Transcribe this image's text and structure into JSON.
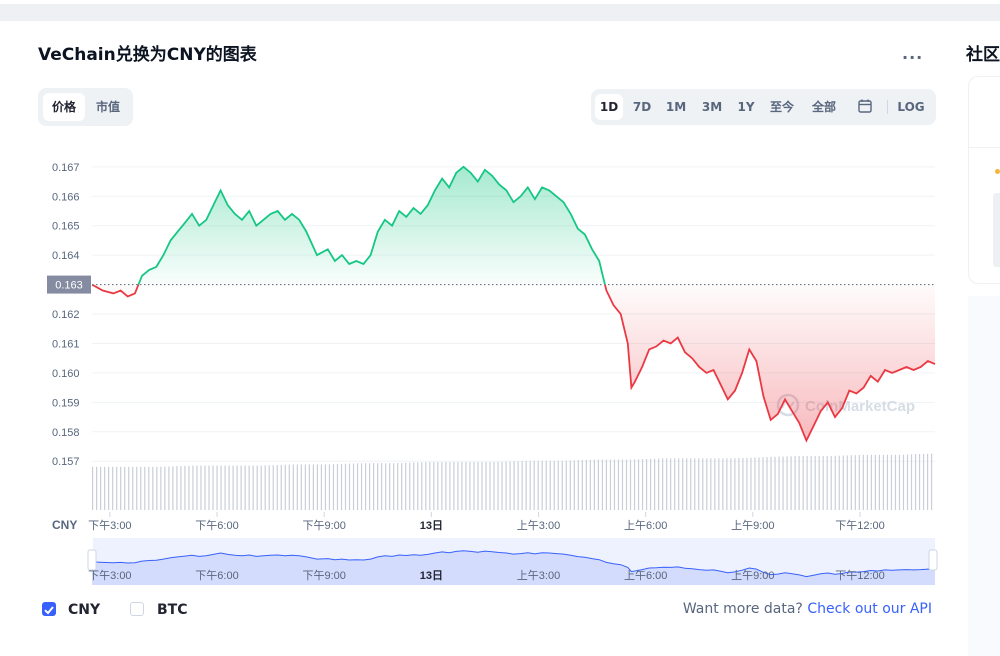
{
  "page": {
    "title": "VeChain兑换为CNY的图表",
    "more_label": "...",
    "side_title": "社区"
  },
  "tabs": [
    "价格",
    "市值"
  ],
  "ranges": [
    "1D",
    "7D",
    "1M",
    "3M",
    "1Y",
    "至今",
    "全部",
    "LOG"
  ],
  "range_active": "1D",
  "icons": {
    "calendar": "calendar-icon",
    "check": "check-icon",
    "watermark": "coinmarketcap-logo-icon"
  },
  "colors": {
    "up": "#16c784",
    "down": "#ea3943",
    "accent": "#3861fb",
    "grid": "#eff2f5",
    "text_muted": "#58667e"
  },
  "watermark": "CoinMarketCap",
  "currency_label": "CNY",
  "legend": {
    "cny": {
      "label": "CNY",
      "checked": true
    },
    "btc": {
      "label": "BTC",
      "checked": false
    }
  },
  "footer": {
    "prefix": "Want more data?",
    "link": "Check out our API"
  },
  "chart_data": {
    "type": "area",
    "y_ticks": [
      "0.167",
      "0.166",
      "0.165",
      "0.164",
      "0.163",
      "0.162",
      "0.161",
      "0.160",
      "0.159",
      "0.158",
      "0.157"
    ],
    "ylim": [
      0.1566,
      0.1673
    ],
    "baseline": 0.163,
    "baseline_label": "0.163",
    "x_ticks": [
      "下午3:00",
      "下午6:00",
      "下午9:00",
      "13日",
      "上午3:00",
      "上午6:00",
      "上午9:00",
      "下午12:00"
    ],
    "xlim": [
      0,
      23.6
    ],
    "x_tick_positions": [
      0.5,
      3.5,
      6.5,
      9.5,
      12.5,
      15.5,
      18.5,
      21.5
    ],
    "series": [
      {
        "x": [
          0,
          0.3,
          0.6,
          0.8,
          1.0,
          1.2,
          1.2,
          1.4,
          1.6,
          1.8,
          2.0,
          2.2,
          2.4,
          2.6,
          2.8,
          3.0,
          3.2,
          3.4,
          3.6,
          3.8,
          4.0,
          4.2,
          4.4,
          4.6,
          4.8,
          5.0,
          5.2,
          5.4,
          5.6,
          5.8,
          6.0,
          6.3,
          6.6,
          6.8,
          7.0,
          7.2,
          7.4,
          7.6,
          7.8,
          8.0,
          8.2,
          8.4,
          8.6,
          8.8,
          9.0,
          9.2,
          9.4,
          9.6,
          9.8,
          10.0,
          10.2,
          10.4,
          10.6,
          10.8,
          11.0,
          11.2,
          11.4,
          11.6,
          11.8,
          12.0,
          12.2,
          12.4,
          12.6,
          12.8,
          13.0,
          13.2,
          13.4,
          13.6,
          13.8,
          14.0,
          14.2,
          14.4,
          14.6,
          14.8,
          15.0,
          15.1,
          15.2,
          15.4,
          15.6,
          15.8,
          16.0,
          16.2,
          16.4,
          16.6,
          16.8,
          17.0,
          17.2,
          17.4,
          17.6,
          17.8,
          18.0,
          18.2,
          18.4,
          18.6,
          18.8,
          19.0,
          19.2,
          19.4,
          19.6,
          19.8,
          20.0,
          20.2,
          20.4,
          20.6,
          20.8,
          21.0,
          21.2,
          21.4,
          21.6,
          21.8,
          22.0,
          22.2,
          22.4,
          22.6,
          22.8,
          23.0,
          23.2,
          23.4,
          23.6
        ],
        "values": [
          0.163,
          0.1628,
          0.1627,
          0.1628,
          0.1626,
          0.1627,
          0.1627,
          0.1633,
          0.1635,
          0.1636,
          0.164,
          0.1645,
          0.1648,
          0.1651,
          0.1654,
          0.165,
          0.1652,
          0.1657,
          0.1662,
          0.1657,
          0.1654,
          0.1652,
          0.1655,
          0.165,
          0.1652,
          0.1654,
          0.1655,
          0.1652,
          0.1654,
          0.1652,
          0.1648,
          0.164,
          0.1642,
          0.1638,
          0.164,
          0.1637,
          0.1638,
          0.1637,
          0.164,
          0.1648,
          0.1652,
          0.165,
          0.1655,
          0.1653,
          0.1656,
          0.1654,
          0.1657,
          0.1662,
          0.1666,
          0.1663,
          0.1668,
          0.167,
          0.1668,
          0.1665,
          0.1669,
          0.1667,
          0.1664,
          0.1662,
          0.1658,
          0.166,
          0.1663,
          0.1659,
          0.1663,
          0.1662,
          0.166,
          0.1658,
          0.1654,
          0.1649,
          0.1647,
          0.1642,
          0.1638,
          0.1628,
          0.1623,
          0.162,
          0.161,
          0.1595,
          0.1597,
          0.1602,
          0.1608,
          0.1609,
          0.1611,
          0.161,
          0.1612,
          0.1607,
          0.1605,
          0.1602,
          0.16,
          0.1601,
          0.1596,
          0.1591,
          0.1594,
          0.16,
          0.1608,
          0.1604,
          0.1592,
          0.1584,
          0.1586,
          0.1591,
          0.1587,
          0.1583,
          0.1577,
          0.1582,
          0.1587,
          0.159,
          0.1585,
          0.1588,
          0.1594,
          0.1593,
          0.1595,
          0.1599,
          0.1597,
          0.1601,
          0.16,
          0.1601,
          0.1602,
          0.1601,
          0.1602,
          0.1604,
          0.1603
        ]
      }
    ],
    "volume": [
      0.36,
      0.36,
      0.36,
      0.37,
      0.37,
      0.37,
      0.38,
      0.38,
      0.39,
      0.39,
      0.4,
      0.4,
      0.4,
      0.41,
      0.41,
      0.42,
      0.42,
      0.43,
      0.43,
      0.43,
      0.44,
      0.45,
      0.45,
      0.46,
      0.46,
      0.47
    ],
    "navigator_labels": [
      "下午3:00",
      "下午6:00",
      "下午9:00",
      "13日",
      "上午3:00",
      "上午6:00",
      "上午9:00",
      "下午12:00"
    ]
  }
}
